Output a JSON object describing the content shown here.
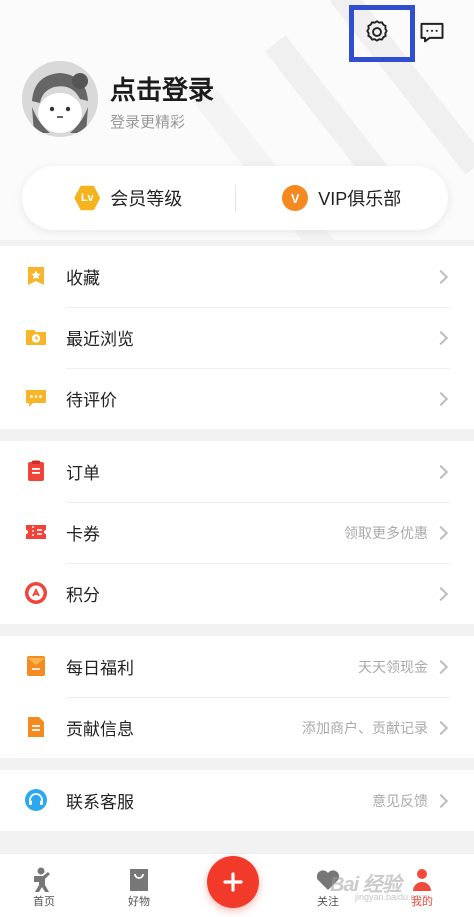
{
  "header": {
    "login_title": "点击登录",
    "login_subtitle": "登录更精彩",
    "settings_icon": "gear-icon",
    "messages_icon": "chat-bubble-icon"
  },
  "membership": {
    "level_label": "会员等级",
    "level_badge": "Lv",
    "vip_label": "VIP俱乐部",
    "vip_badge": "V"
  },
  "groups": [
    {
      "items": [
        {
          "label": "收藏",
          "hint": "",
          "icon": "star-bookmark-icon"
        },
        {
          "label": "最近浏览",
          "hint": "",
          "icon": "clock-folder-icon"
        },
        {
          "label": "待评价",
          "hint": "",
          "icon": "comment-dots-icon"
        }
      ]
    },
    {
      "items": [
        {
          "label": "订单",
          "hint": "",
          "icon": "order-clipboard-icon"
        },
        {
          "label": "卡券",
          "hint": "领取更多优惠",
          "icon": "coupon-ticket-icon"
        },
        {
          "label": "积分",
          "hint": "",
          "icon": "points-coin-icon"
        }
      ]
    },
    {
      "items": [
        {
          "label": "每日福利",
          "hint": "天天领现金",
          "icon": "envelope-icon"
        },
        {
          "label": "贡献信息",
          "hint": "添加商户、贡献记录",
          "icon": "document-icon"
        }
      ]
    },
    {
      "items": [
        {
          "label": "联系客服",
          "hint": "意见反馈",
          "icon": "headset-icon"
        }
      ]
    }
  ],
  "tabbar": {
    "tabs": [
      {
        "label": "首页",
        "icon": "home-figure-icon"
      },
      {
        "label": "好物",
        "icon": "shopping-bag-icon"
      },
      {
        "label": "",
        "icon": "plus-icon"
      },
      {
        "label": "关注",
        "icon": "heart-icon"
      },
      {
        "label": "我的",
        "icon": "person-icon"
      }
    ],
    "active_tab": "我的"
  },
  "watermark": {
    "brand": "Bai 经验",
    "site": "jingyan.baidu.com"
  },
  "colors": {
    "accent_red": "#f23a2a",
    "gold": "#f5b41e",
    "orange": "#f5881f",
    "highlight_box": "#2f4fcf"
  }
}
